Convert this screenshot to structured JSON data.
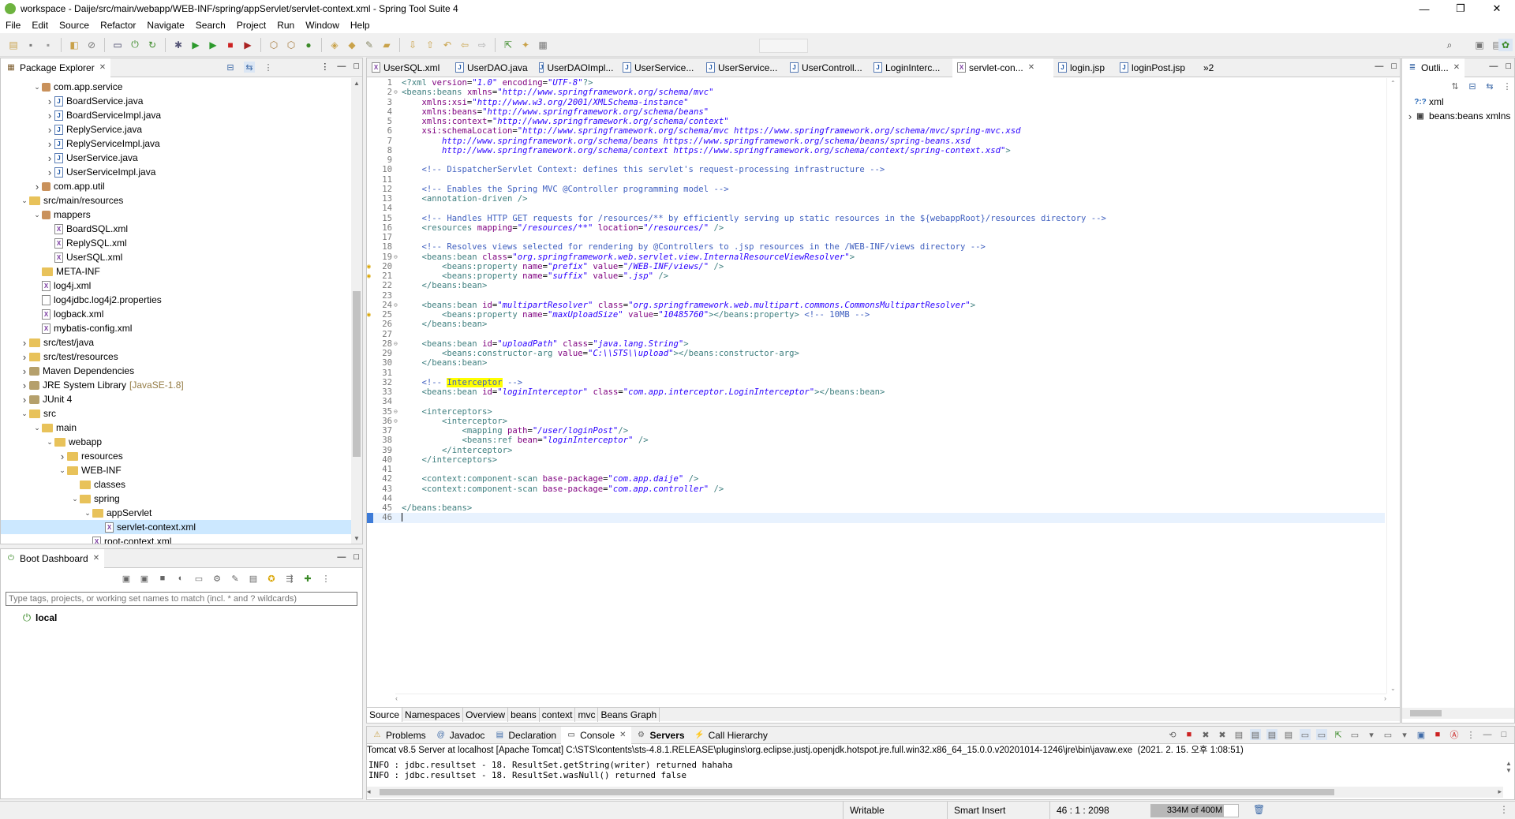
{
  "window": {
    "title": "workspace - Daije/src/main/webapp/WEB-INF/spring/appServlet/servlet-context.xml - Spring Tool Suite 4",
    "controls": [
      "—",
      "❐",
      "✕"
    ]
  },
  "menu": [
    "File",
    "Edit",
    "Source",
    "Refactor",
    "Navigate",
    "Search",
    "Project",
    "Run",
    "Window",
    "Help"
  ],
  "package_explorer": {
    "title": "Package Explorer",
    "rows": [
      {
        "indent": 2,
        "tw": "v",
        "icon": "pkg",
        "label": "com.app.service"
      },
      {
        "indent": 3,
        "tw": ">",
        "icon": "java",
        "label": "BoardService.java"
      },
      {
        "indent": 3,
        "tw": ">",
        "icon": "java",
        "label": "BoardServiceImpl.java"
      },
      {
        "indent": 3,
        "tw": ">",
        "icon": "java",
        "label": "ReplyService.java"
      },
      {
        "indent": 3,
        "tw": ">",
        "icon": "java",
        "label": "ReplyServiceImpl.java"
      },
      {
        "indent": 3,
        "tw": ">",
        "icon": "java",
        "label": "UserService.java"
      },
      {
        "indent": 3,
        "tw": ">",
        "icon": "java",
        "label": "UserServiceImpl.java"
      },
      {
        "indent": 2,
        "tw": ">",
        "icon": "pkg",
        "label": "com.app.util"
      },
      {
        "indent": 1,
        "tw": "v",
        "icon": "folder",
        "label": "src/main/resources"
      },
      {
        "indent": 2,
        "tw": "v",
        "icon": "pkg",
        "label": "mappers"
      },
      {
        "indent": 3,
        "tw": "",
        "icon": "xml",
        "label": "BoardSQL.xml"
      },
      {
        "indent": 3,
        "tw": "",
        "icon": "xml",
        "label": "ReplySQL.xml"
      },
      {
        "indent": 3,
        "tw": "",
        "icon": "xml",
        "label": "UserSQL.xml"
      },
      {
        "indent": 2,
        "tw": "",
        "icon": "folder",
        "label": "META-INF"
      },
      {
        "indent": 2,
        "tw": "",
        "icon": "xml",
        "label": "log4j.xml"
      },
      {
        "indent": 2,
        "tw": "",
        "icon": "file",
        "label": "log4jdbc.log4j2.properties"
      },
      {
        "indent": 2,
        "tw": "",
        "icon": "xml",
        "label": "logback.xml"
      },
      {
        "indent": 2,
        "tw": "",
        "icon": "xml",
        "label": "mybatis-config.xml"
      },
      {
        "indent": 1,
        "tw": ">",
        "icon": "folder",
        "label": "src/test/java"
      },
      {
        "indent": 1,
        "tw": ">",
        "icon": "folder",
        "label": "src/test/resources"
      },
      {
        "indent": 1,
        "tw": ">",
        "icon": "lib",
        "label": "Maven Dependencies"
      },
      {
        "indent": 1,
        "tw": ">",
        "icon": "lib",
        "label": "JRE System Library",
        "suffix": "[JavaSE-1.8]"
      },
      {
        "indent": 1,
        "tw": ">",
        "icon": "lib",
        "label": "JUnit 4"
      },
      {
        "indent": 1,
        "tw": "v",
        "icon": "folder",
        "label": "src"
      },
      {
        "indent": 2,
        "tw": "v",
        "icon": "folder",
        "label": "main"
      },
      {
        "indent": 3,
        "tw": "v",
        "icon": "folder",
        "label": "webapp"
      },
      {
        "indent": 4,
        "tw": ">",
        "icon": "folder",
        "label": "resources"
      },
      {
        "indent": 4,
        "tw": "v",
        "icon": "folder",
        "label": "WEB-INF"
      },
      {
        "indent": 5,
        "tw": "",
        "icon": "folder",
        "label": "classes"
      },
      {
        "indent": 5,
        "tw": "v",
        "icon": "folder",
        "label": "spring"
      },
      {
        "indent": 6,
        "tw": "v",
        "icon": "folder",
        "label": "appServlet"
      },
      {
        "indent": 7,
        "tw": "",
        "icon": "xml",
        "label": "servlet-context.xml",
        "selected": true
      },
      {
        "indent": 6,
        "tw": "",
        "icon": "xml",
        "label": "root-context.xml"
      }
    ]
  },
  "boot_dashboard": {
    "title": "Boot Dashboard",
    "filter_placeholder": "Type tags, projects, or working set names to match (incl. * and ? wildcards)",
    "items": [
      "local"
    ]
  },
  "editor": {
    "tabs": [
      "UserSQL.xml",
      "UserDAO.java",
      "UserDAOImpl...",
      "UserService...",
      "UserService...",
      "UserControll...",
      "LoginInterc...",
      "servlet-con...",
      "login.jsp",
      "loginPost.jsp"
    ],
    "active_tab": 7,
    "overflow": "»2",
    "bottom_tabs": [
      "Source",
      "Namespaces",
      "Overview",
      "beans",
      "context",
      "mvc",
      "Beans Graph"
    ]
  },
  "code_lines": [
    {
      "n": "1",
      "html": "<span class=\"tag\">&lt;?xml</span> <span class=\"attr\">version</span>=<span class=\"val\">\"1.0\"</span> <span class=\"attr\">encoding</span>=<span class=\"val\">\"UTF-8\"</span><span class=\"tag\">?&gt;</span>"
    },
    {
      "n": "2",
      "fold": "⊖",
      "html": "<span class=\"tag\">&lt;beans:beans</span> <span class=\"attr\">xmlns</span>=<span class=\"val\">\"http://www.springframework.org/schema/mvc\"</span>"
    },
    {
      "n": "3",
      "html": "    <span class=\"attr\">xmlns:xsi</span>=<span class=\"val\">\"http://www.w3.org/2001/XMLSchema-instance\"</span>"
    },
    {
      "n": "4",
      "html": "    <span class=\"attr\">xmlns:beans</span>=<span class=\"val\">\"http://www.springframework.org/schema/beans\"</span>"
    },
    {
      "n": "5",
      "html": "    <span class=\"attr\">xmlns:context</span>=<span class=\"val\">\"http://www.springframework.org/schema/context\"</span>"
    },
    {
      "n": "6",
      "html": "    <span class=\"attr\">xsi:schemaLocation</span>=<span class=\"val\">\"http://www.springframework.org/schema/mvc https://www.springframework.org/schema/mvc/spring-mvc.xsd</span>"
    },
    {
      "n": "7",
      "html": "        <span class=\"val\">http://www.springframework.org/schema/beans https://www.springframework.org/schema/beans/spring-beans.xsd</span>"
    },
    {
      "n": "8",
      "html": "        <span class=\"val\">http://www.springframework.org/schema/context https://www.springframework.org/schema/context/spring-context.xsd\"</span><span class=\"tag\">&gt;</span>"
    },
    {
      "n": "9",
      "html": ""
    },
    {
      "n": "10",
      "html": "    <span class=\"cmt\">&lt;!-- DispatcherServlet Context: defines this servlet's request-processing infrastructure --&gt;</span>"
    },
    {
      "n": "11",
      "html": ""
    },
    {
      "n": "12",
      "html": "    <span class=\"cmt\">&lt;!-- Enables the Spring MVC @Controller programming model --&gt;</span>"
    },
    {
      "n": "13",
      "html": "    <span class=\"tag\">&lt;annotation-driven /&gt;</span>"
    },
    {
      "n": "14",
      "html": ""
    },
    {
      "n": "15",
      "html": "    <span class=\"cmt\">&lt;!-- Handles HTTP GET requests for /resources/** by efficiently serving up static resources in the ${webappRoot}/resources directory --&gt;</span>"
    },
    {
      "n": "16",
      "html": "    <span class=\"tag\">&lt;resources</span> <span class=\"attr\">mapping</span>=<span class=\"val\">\"/resources/**\"</span> <span class=\"attr\">location</span>=<span class=\"val\">\"/resources/\"</span> <span class=\"tag\">/&gt;</span>"
    },
    {
      "n": "17",
      "html": ""
    },
    {
      "n": "18",
      "html": "    <span class=\"cmt\">&lt;!-- Resolves views selected for rendering by @Controllers to .jsp resources in the /WEB-INF/views directory --&gt;</span>"
    },
    {
      "n": "19",
      "fold": "⊖",
      "html": "    <span class=\"tag\">&lt;beans:bean</span> <span class=\"attr\">class</span>=<span class=\"val\">\"org.springframework.web.servlet.view.InternalResourceViewResolver\"</span><span class=\"tag\">&gt;</span>"
    },
    {
      "n": "20",
      "marker": true,
      "html": "        <span class=\"tag\">&lt;beans:property</span> <span class=\"attr\">name</span>=<span class=\"val\">\"prefix\"</span> <span class=\"attr\">value</span>=<span class=\"val\">\"/WEB-INF/views/\"</span> <span class=\"tag\">/&gt;</span>"
    },
    {
      "n": "21",
      "marker": true,
      "html": "        <span class=\"tag\">&lt;beans:property</span> <span class=\"attr\">name</span>=<span class=\"val\">\"suffix\"</span> <span class=\"attr\">value</span>=<span class=\"val\">\".jsp\"</span> <span class=\"tag\">/&gt;</span>"
    },
    {
      "n": "22",
      "html": "    <span class=\"tag\">&lt;/beans:bean&gt;</span>"
    },
    {
      "n": "23",
      "html": ""
    },
    {
      "n": "24",
      "fold": "⊖",
      "html": "    <span class=\"tag\">&lt;beans:bean</span> <span class=\"attr\">id</span>=<span class=\"val\">\"multipartResolver\"</span> <span class=\"attr\">class</span>=<span class=\"val\">\"org.springframework.web.multipart.commons.CommonsMultipartResolver\"</span><span class=\"tag\">&gt;</span>"
    },
    {
      "n": "25",
      "marker": true,
      "html": "        <span class=\"tag\">&lt;beans:property</span> <span class=\"attr\">name</span>=<span class=\"val\">\"maxUploadSize\"</span> <span class=\"attr\">value</span>=<span class=\"val\">\"10485760\"</span><span class=\"tag\">&gt;&lt;/beans:property&gt;</span> <span class=\"cmt\">&lt;!-- 10MB --&gt;</span>"
    },
    {
      "n": "26",
      "html": "    <span class=\"tag\">&lt;/beans:bean&gt;</span>"
    },
    {
      "n": "27",
      "html": ""
    },
    {
      "n": "28",
      "fold": "⊖",
      "html": "    <span class=\"tag\">&lt;beans:bean</span> <span class=\"attr\">id</span>=<span class=\"val\">\"uploadPath\"</span> <span class=\"attr\">class</span>=<span class=\"val\">\"java.lang.String\"</span><span class=\"tag\">&gt;</span>"
    },
    {
      "n": "29",
      "html": "        <span class=\"tag\">&lt;beans:constructor-arg</span> <span class=\"attr\">value</span>=<span class=\"val\">\"C:\\\\STS\\\\upload\"</span><span class=\"tag\">&gt;&lt;/beans:constructor-arg&gt;</span>"
    },
    {
      "n": "30",
      "html": "    <span class=\"tag\">&lt;/beans:bean&gt;</span>"
    },
    {
      "n": "31",
      "html": ""
    },
    {
      "n": "32",
      "html": "    <span class=\"cmt\">&lt;!-- <span class=\"hl\">Interceptor</span> --&gt;</span>"
    },
    {
      "n": "33",
      "html": "    <span class=\"tag\">&lt;beans:bean</span> <span class=\"attr\">id</span>=<span class=\"val\">\"loginInterceptor\"</span> <span class=\"attr\">class</span>=<span class=\"val\">\"com.app.interceptor.LoginInterceptor\"</span><span class=\"tag\">&gt;&lt;/beans:bean&gt;</span>"
    },
    {
      "n": "34",
      "html": ""
    },
    {
      "n": "35",
      "fold": "⊖",
      "html": "    <span class=\"tag\">&lt;interceptors&gt;</span>"
    },
    {
      "n": "36",
      "fold": "⊖",
      "html": "        <span class=\"tag\">&lt;interceptor&gt;</span>"
    },
    {
      "n": "37",
      "html": "            <span class=\"tag\">&lt;mapping</span> <span class=\"attr\">path</span>=<span class=\"val\">\"/user/loginPost\"</span><span class=\"tag\">/&gt;</span>"
    },
    {
      "n": "38",
      "html": "            <span class=\"tag\">&lt;beans:ref</span> <span class=\"attr\">bean</span>=<span class=\"val\">\"loginInterceptor\"</span> <span class=\"tag\">/&gt;</span>"
    },
    {
      "n": "39",
      "html": "        <span class=\"tag\">&lt;/interceptor&gt;</span>"
    },
    {
      "n": "40",
      "html": "    <span class=\"tag\">&lt;/interceptors&gt;</span>"
    },
    {
      "n": "41",
      "html": ""
    },
    {
      "n": "42",
      "html": "    <span class=\"tag\">&lt;context:component-scan</span> <span class=\"attr\">base-package</span>=<span class=\"val\">\"com.app.daije\"</span> <span class=\"tag\">/&gt;</span>"
    },
    {
      "n": "43",
      "html": "    <span class=\"tag\">&lt;context:component-scan</span> <span class=\"attr\">base-package</span>=<span class=\"val\">\"com.app.controller\"</span> <span class=\"tag\">/&gt;</span>"
    },
    {
      "n": "44",
      "html": ""
    },
    {
      "n": "45",
      "html": "<span class=\"tag\">&lt;/beans:beans&gt;</span>"
    },
    {
      "n": "46",
      "cursor": true,
      "html": ""
    }
  ],
  "outline": {
    "title": "Outli...",
    "rows": [
      {
        "tw": "",
        "icon": "?",
        "label": "xml"
      },
      {
        "tw": ">",
        "icon": "e",
        "label": "beans:beans xmlns"
      }
    ]
  },
  "bottom_panel": {
    "tabs": [
      "Problems",
      "Javadoc",
      "Declaration",
      "Console",
      "Servers",
      "Call Hierarchy"
    ],
    "active_tab": 3,
    "bold_tab": 4,
    "header": "Tomcat v8.5 Server at localhost [Apache Tomcat] C:\\STS\\contents\\sts-4.8.1.RELEASE\\plugins\\org.eclipse.justj.openjdk.hotspot.jre.full.win32.x86_64_15.0.0.v20201014-1246\\jre\\bin\\javaw.exe  (2021. 2. 15. 오후 1:08:51)",
    "lines": [
      "INFO : jdbc.resultset - 18. ResultSet.getString(writer) returned hahaha",
      "INFO : jdbc.resultset - 18. ResultSet.wasNull() returned false"
    ]
  },
  "status": {
    "writable": "Writable",
    "insert_mode": "Smart Insert",
    "position": "46 : 1 : 2098",
    "memory": "334M of 400M",
    "memory_fraction": 0.835
  }
}
